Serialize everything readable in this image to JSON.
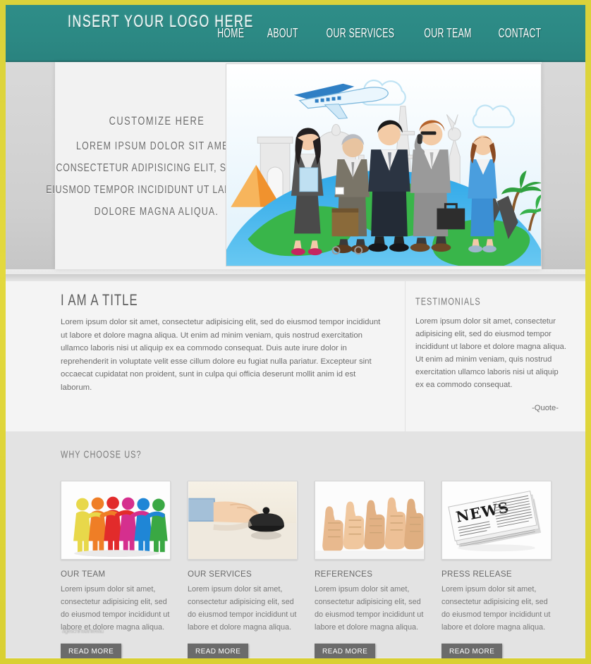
{
  "theme": {
    "frame_color": "#dad23a",
    "header_color": "#2b8a86",
    "page_bg": "#ececec",
    "band_bg": "#e3e3e3",
    "button_color": "#6b6b6b",
    "text_color": "#6d6d6d"
  },
  "header": {
    "logo": "INSERT YOUR LOGO HERE",
    "nav": [
      {
        "label": "HOME"
      },
      {
        "label": "ABOUT"
      },
      {
        "label": "OUR SERVICES"
      },
      {
        "label": "OUR TEAM"
      },
      {
        "label": "CONTACT"
      }
    ]
  },
  "hero": {
    "title": "CUSTOMIZE HERE",
    "lines": [
      "LOREM IPSUM DOLOR SIT AMET,",
      "CONSECTETUR ADIPISICING ELIT, SED DO",
      "EIUSMOD TEMPOR INCIDIDUNT UT LABORE ET",
      "DOLORE MAGNA ALIQUA."
    ],
    "image_name": "business-travel-globe-illustration"
  },
  "content": {
    "title": "I AM A TITLE",
    "body": "Lorem ipsum dolor sit amet, consectetur adipisicing elit, sed do eiusmod tempor incididunt ut labore et dolore magna aliqua. Ut enim ad minim veniam, quis nostrud exercitation ullamco laboris nisi ut aliquip ex ea commodo consequat. Duis aute irure dolor in reprehenderit in voluptate velit esse cillum dolore eu fugiat nulla pariatur. Excepteur sint occaecat cupidatat non proident, sunt in culpa qui officia deserunt mollit anim id est laborum."
  },
  "testimonials": {
    "title": "TESTIMONIALS",
    "body": "Lorem ipsum dolor sit amet, consectetur adipisicing elit, sed do eiusmod tempor incididunt ut labore et dolore magna aliqua. Ut enim ad minim veniam, quis nostrud exercitation ullamco laboris nisi ut aliquip ex ea commodo consequat.",
    "attribution": "-Quote-"
  },
  "why_choose_us": {
    "title": "WHY CHOOSE US?",
    "watermark": "agescninstanteeau",
    "cards": [
      {
        "heading": "OUR TEAM",
        "body": "Lorem ipsum dolor sit amet, consectetur adipisicing elit, sed do eiusmod tempor incididunt ut labore et dolore magna aliqua.",
        "button": "READ MORE",
        "image_name": "colorful-people-group-icon"
      },
      {
        "heading": "OUR SERVICES",
        "body": "Lorem ipsum dolor sit amet, consectetur adipisicing elit, sed do eiusmod tempor incididunt ut labore et dolore magna aliqua.",
        "button": "READ MORE",
        "image_name": "hand-service-bell-photo"
      },
      {
        "heading": "REFERENCES",
        "body": "Lorem ipsum dolor sit amet, consectetur adipisicing elit, sed do eiusmod tempor incididunt ut labore et dolore magna aliqua.",
        "button": "READ MORE",
        "image_name": "thumbs-up-hands-photo"
      },
      {
        "heading": "PRESS RELEASE",
        "body": "Lorem ipsum dolor sit amet, consectetur adipisicing elit, sed do eiusmod tempor incididunt ut labore et dolore magna aliqua.",
        "button": "READ MORE",
        "image_name": "newspaper-news-photo"
      }
    ]
  }
}
